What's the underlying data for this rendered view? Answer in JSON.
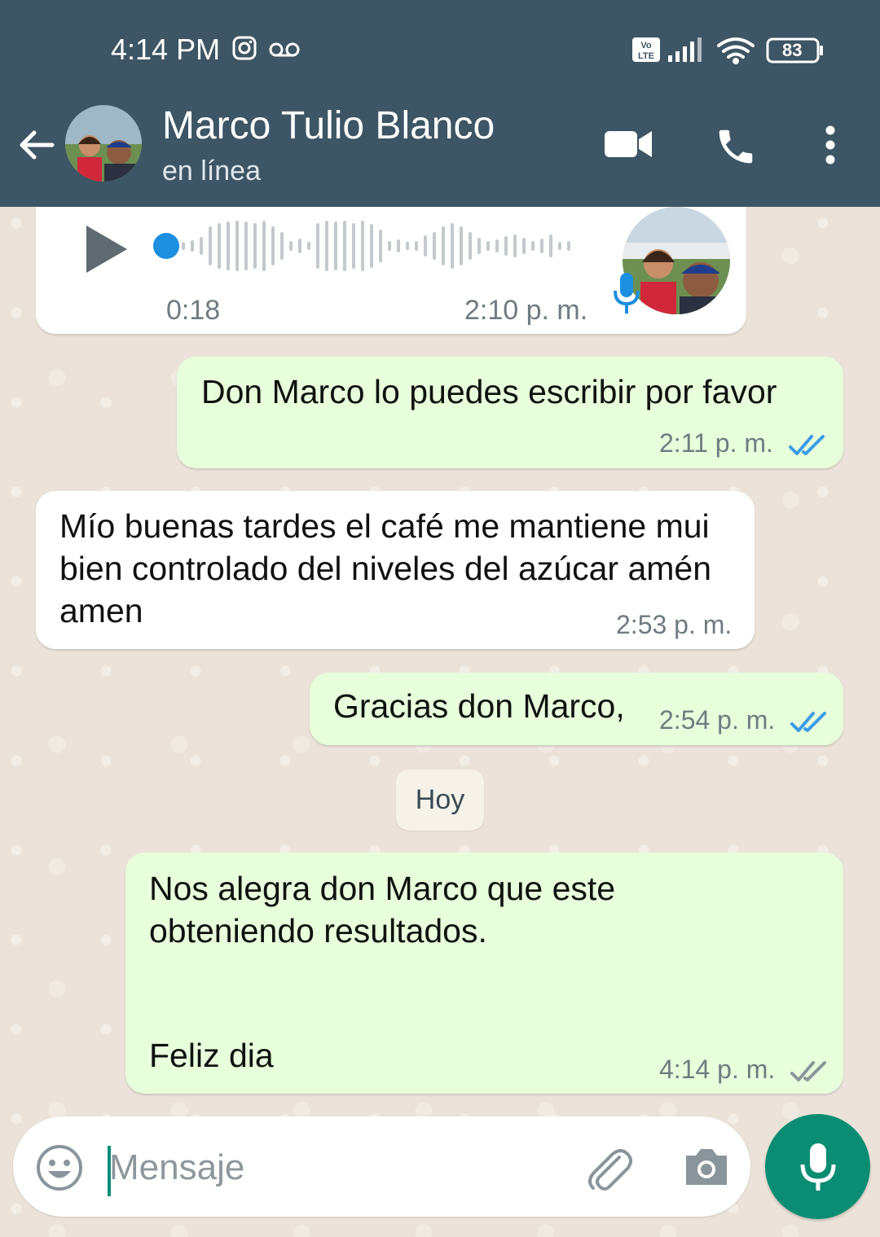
{
  "status_bar": {
    "time": "4:14 PM",
    "battery": "83",
    "network_badge": "Vo LTE"
  },
  "header": {
    "contact_name": "Marco Tulio Blanco",
    "status": "en línea",
    "icons": [
      "back-arrow-icon",
      "video-call-icon",
      "phone-icon",
      "more-vert-icon"
    ]
  },
  "messages": {
    "voice": {
      "duration": "0:18",
      "time": "2:10 p. m."
    },
    "m1": {
      "text": "Don Marco lo puedes escribir por favor",
      "time": "2:11 p. m."
    },
    "m2": {
      "text": "Mío buenas tardes el café me mantiene mui bien controlado del niveles del azúcar amén amen",
      "time": "2:53 p. m."
    },
    "m3": {
      "text": "Gracias don Marco,",
      "time": "2:54 p. m."
    },
    "day_divider": "Hoy",
    "m4": {
      "line1": "Nos alegra don Marco que este obteniendo resultados.",
      "line2": "Feliz dia",
      "time": "4:14 p. m."
    }
  },
  "composer": {
    "placeholder": "Mensaje"
  },
  "colors": {
    "header_bg": "#3d5564",
    "outgoing_bubble": "#e7ffdb",
    "incoming_bubble": "#ffffff",
    "read_ticks": "#3c9be5",
    "fab": "#0a8d73"
  }
}
